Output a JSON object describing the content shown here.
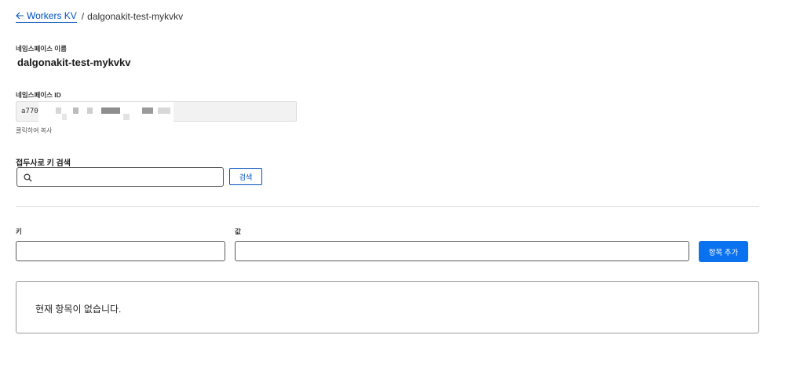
{
  "breadcrumb": {
    "back_label": "Workers KV",
    "separator": "/",
    "current": "dalgonakit-test-mykvkv"
  },
  "namespace": {
    "name_label": "네임스페이스 이름",
    "name_value": "dalgonakit-test-mykvkv",
    "id_label": "네임스페이스 ID",
    "id_value_visible": "a770",
    "copy_hint": "클릭하여 복사"
  },
  "search": {
    "label": "접두사로 키 검색",
    "placeholder": "",
    "button_label": "검색"
  },
  "entry": {
    "key_label": "키",
    "value_label": "값",
    "key_value": "",
    "value_value": "",
    "add_button_label": "항목 추가"
  },
  "empty_state": {
    "message": "현재 항목이 없습니다."
  },
  "colors": {
    "link": "#0051c3",
    "primary_button": "#0a72ef"
  }
}
